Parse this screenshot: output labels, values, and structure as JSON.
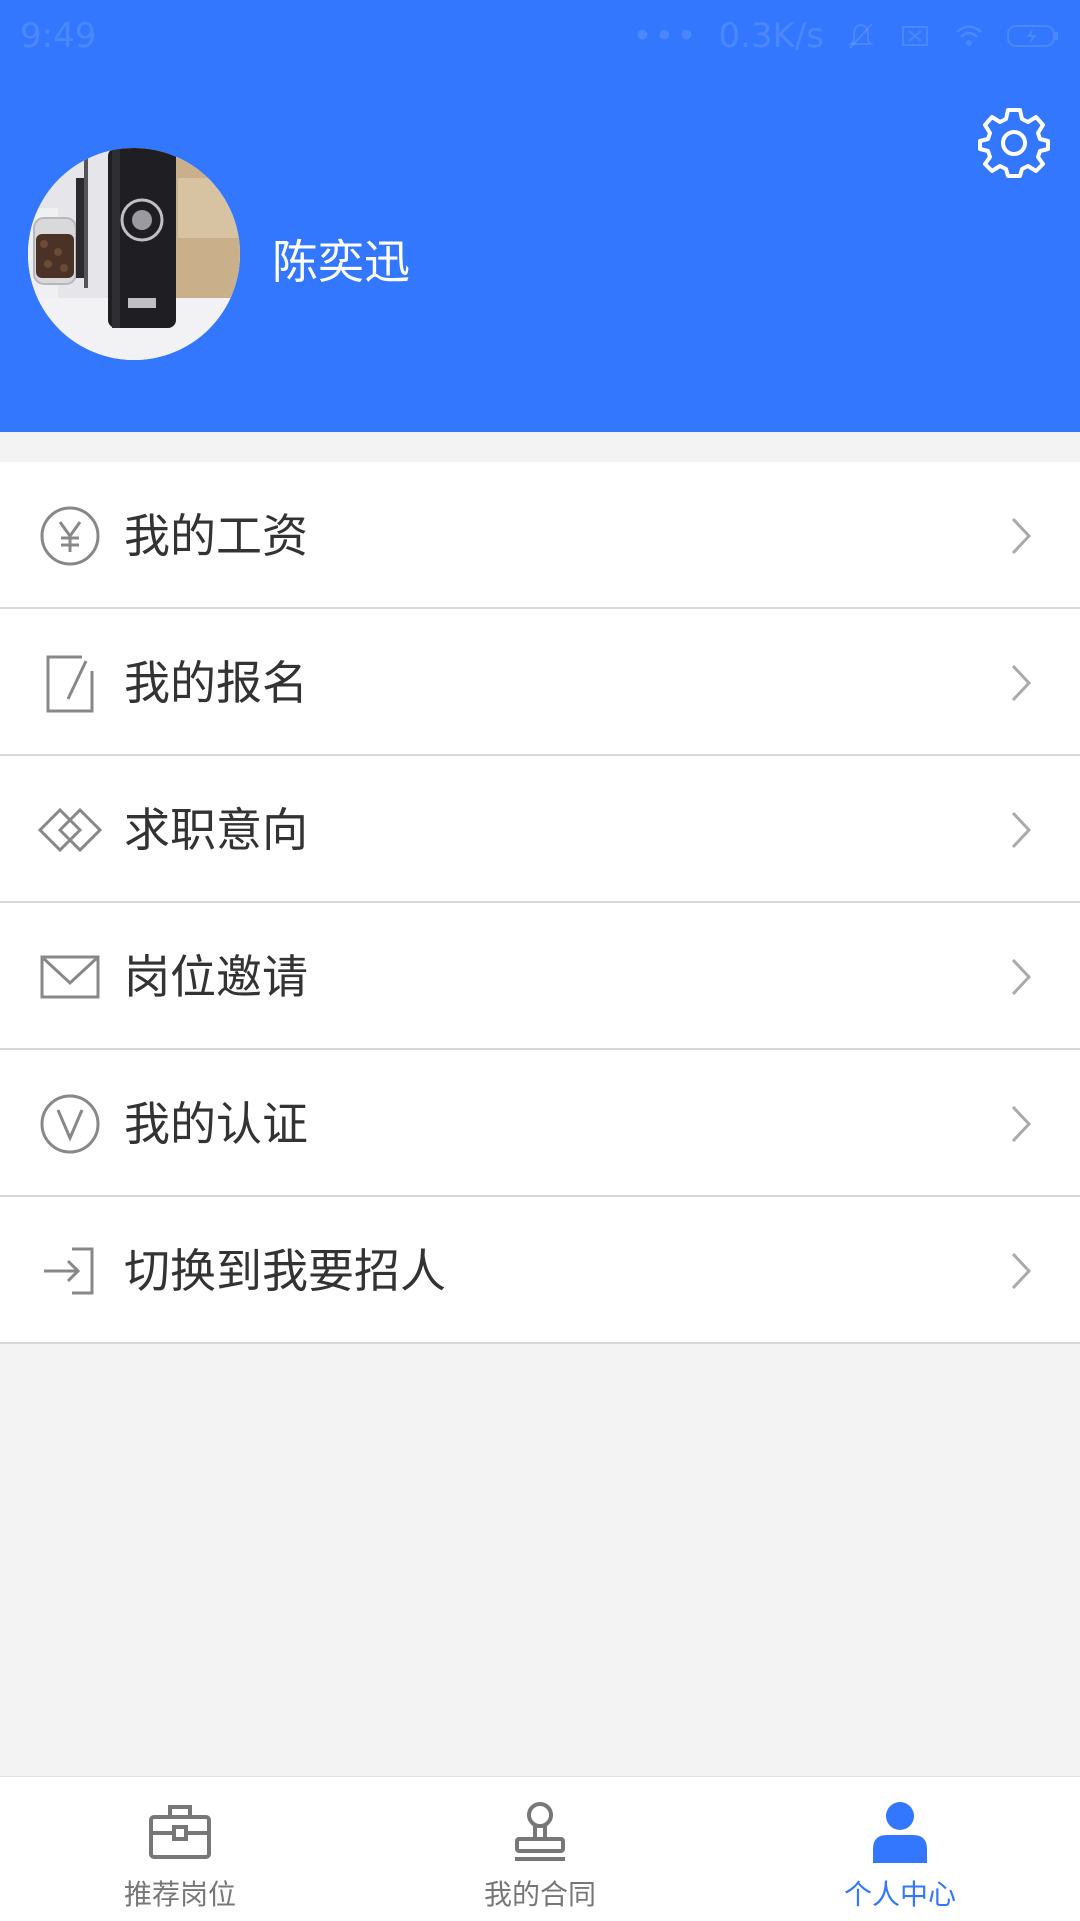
{
  "status_bar": {
    "time": "9:49",
    "network_speed": "0.3K/s",
    "icons": [
      "more-dots-icon",
      "mute-bell-icon",
      "sim-icon",
      "wifi-icon",
      "battery-charging-icon"
    ]
  },
  "header": {
    "background_color": "#3377ff",
    "username": "陈奕迅",
    "settings_icon": "gear-icon"
  },
  "menu": {
    "items": [
      {
        "label": "我的工资",
        "icon": "yuan-circle-icon"
      },
      {
        "label": "我的报名",
        "icon": "edit-note-icon"
      },
      {
        "label": "求职意向",
        "icon": "diamond-icon"
      },
      {
        "label": "岗位邀请",
        "icon": "envelope-icon"
      },
      {
        "label": "我的认证",
        "icon": "verified-v-icon"
      },
      {
        "label": "切换到我要招人",
        "icon": "switch-enter-icon"
      }
    ]
  },
  "tabbar": {
    "active_color": "#3377ff",
    "tabs": [
      {
        "label": "推荐岗位",
        "icon": "briefcase-icon",
        "active": false
      },
      {
        "label": "我的合同",
        "icon": "stamp-icon",
        "active": false
      },
      {
        "label": "个人中心",
        "icon": "person-icon",
        "active": true
      }
    ]
  }
}
